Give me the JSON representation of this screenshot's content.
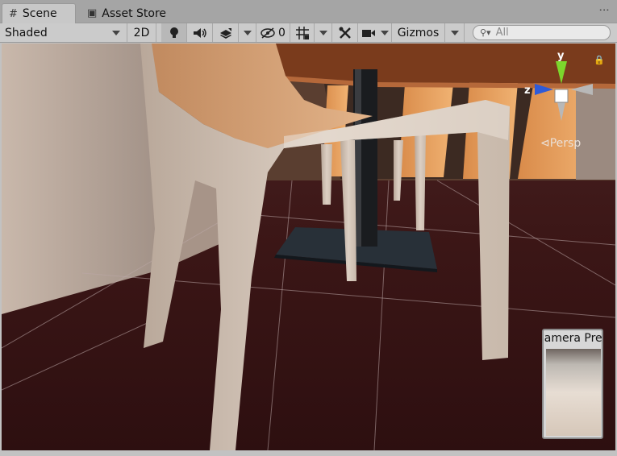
{
  "tabs": [
    {
      "label": "Scene",
      "icon": "grid-icon"
    },
    {
      "label": "Asset Store",
      "icon": "bag-icon"
    }
  ],
  "toolbar": {
    "draw_mode": "Shaded",
    "view_2d": "2D",
    "hidden_count": "0",
    "gizmos": "Gizmos",
    "search_placeholder": "All"
  },
  "viewport": {
    "gizmo_axes": {
      "y": "y",
      "z": "z"
    },
    "projection": "⊲Persp",
    "camera_preview_title": "Camera Preview"
  },
  "colors": {
    "axis_y": "#7cd62c",
    "axis_z": "#2f5bd8",
    "axis_x": "#b8b8b8"
  }
}
